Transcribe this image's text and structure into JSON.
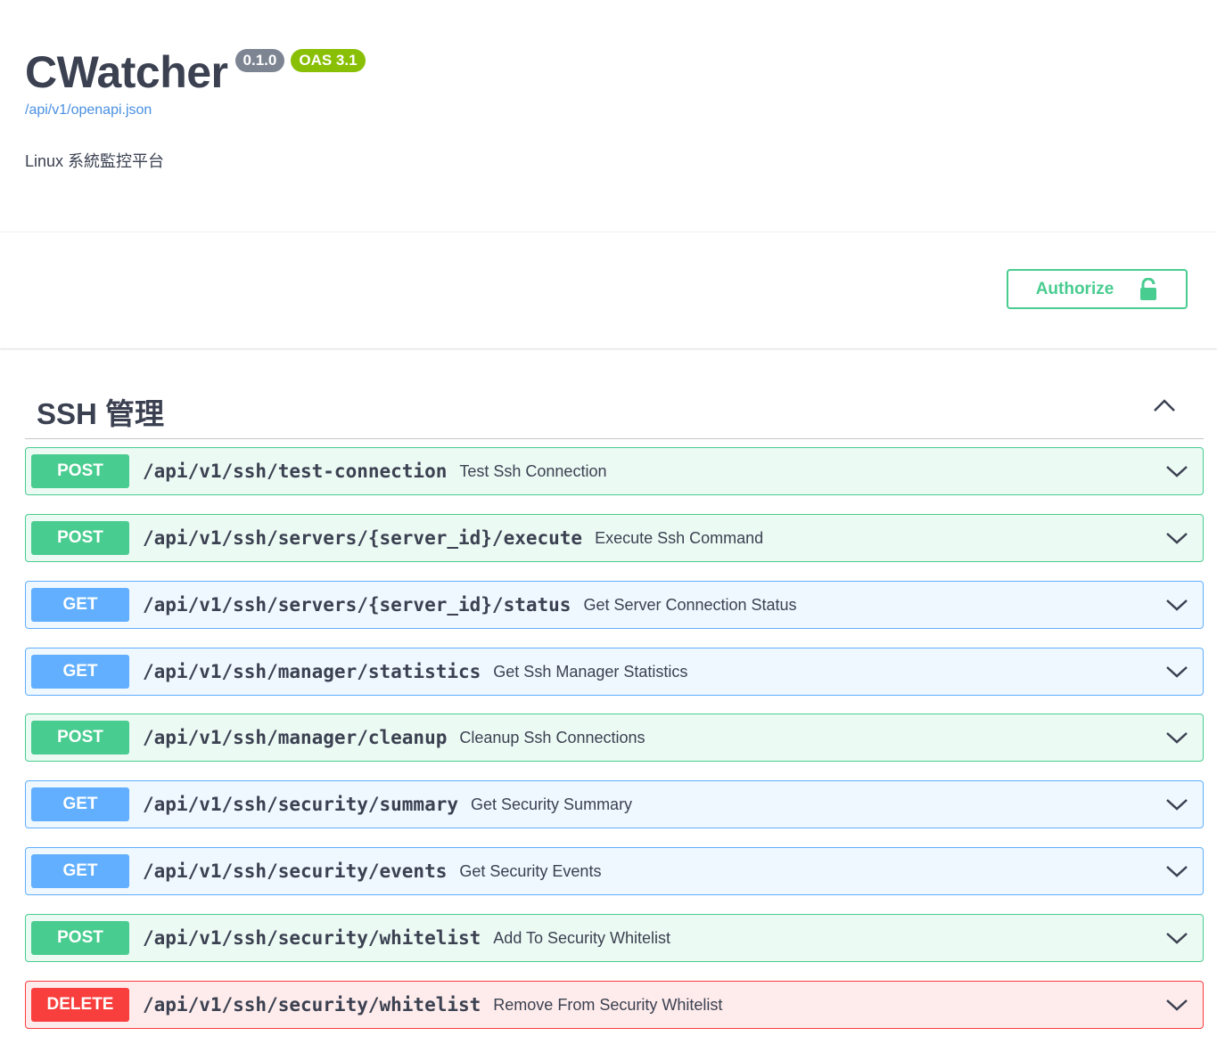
{
  "info": {
    "title": "CWatcher",
    "version": "0.1.0",
    "oas": "OAS 3.1",
    "spec_link": "/api/v1/openapi.json",
    "description": "Linux 系統監控平台"
  },
  "auth": {
    "label": "Authorize",
    "icon": "unlock-icon"
  },
  "tag": {
    "title": "SSH 管理",
    "toggle_icon": "chevron-up-icon"
  },
  "colors": {
    "post": "#49cc90",
    "get": "#61affe",
    "delete": "#f93e3e",
    "text": "#3b4151",
    "link": "#4990e2"
  },
  "operations": [
    {
      "method": "POST",
      "path": "/api/v1/ssh/test-connection",
      "summary": "Test Ssh Connection"
    },
    {
      "method": "POST",
      "path": "/api/v1/ssh/servers/{server_id}/execute",
      "summary": "Execute Ssh Command"
    },
    {
      "method": "GET",
      "path": "/api/v1/ssh/servers/{server_id}/status",
      "summary": "Get Server Connection Status"
    },
    {
      "method": "GET",
      "path": "/api/v1/ssh/manager/statistics",
      "summary": "Get Ssh Manager Statistics"
    },
    {
      "method": "POST",
      "path": "/api/v1/ssh/manager/cleanup",
      "summary": "Cleanup Ssh Connections"
    },
    {
      "method": "GET",
      "path": "/api/v1/ssh/security/summary",
      "summary": "Get Security Summary"
    },
    {
      "method": "GET",
      "path": "/api/v1/ssh/security/events",
      "summary": "Get Security Events"
    },
    {
      "method": "POST",
      "path": "/api/v1/ssh/security/whitelist",
      "summary": "Add To Security Whitelist"
    },
    {
      "method": "DELETE",
      "path": "/api/v1/ssh/security/whitelist",
      "summary": "Remove From Security Whitelist"
    }
  ]
}
